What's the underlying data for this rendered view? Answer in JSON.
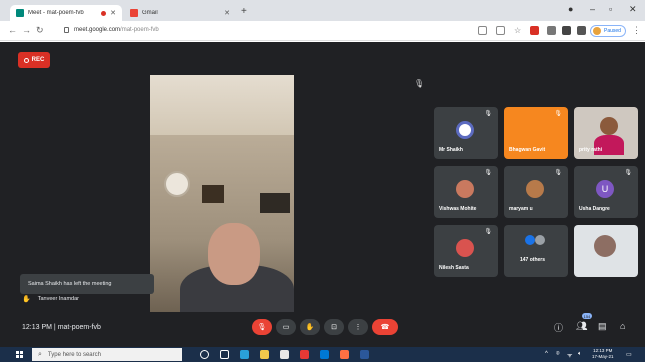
{
  "browser": {
    "tabs": [
      {
        "title": "Meet - mat-poem-fvb"
      },
      {
        "title": "Gmail"
      }
    ],
    "url_host": "meet.google.com",
    "url_path": "/mat-poem-fvb",
    "profile_status": "Paused"
  },
  "meet": {
    "rec_label": "REC",
    "participants": [
      {
        "name": "Mr Shaikh"
      },
      {
        "name": "Bhagwan Gavit"
      },
      {
        "name": "prity rathi"
      },
      {
        "name": "Vishwas Mohite"
      },
      {
        "name": "maryam u"
      },
      {
        "name": "Usha Dangre",
        "initial": "U"
      },
      {
        "name": "Nilesh Sasta"
      },
      {
        "name": "147 others"
      },
      {
        "name": ""
      }
    ],
    "toast": "Saima Shaikh has left the meeting",
    "raised_hand": "Tanveer Inamdar",
    "time": "12:13 PM",
    "meeting_code": "mat-poem-fvb",
    "people_badge": "154",
    "colors": {
      "accent_orange": "#f6871f",
      "red": "#ea4335",
      "bg": "#202124"
    }
  },
  "taskbar": {
    "search_placeholder": "Type here to search",
    "time": "12:13 PM",
    "date": "17-May-21"
  }
}
